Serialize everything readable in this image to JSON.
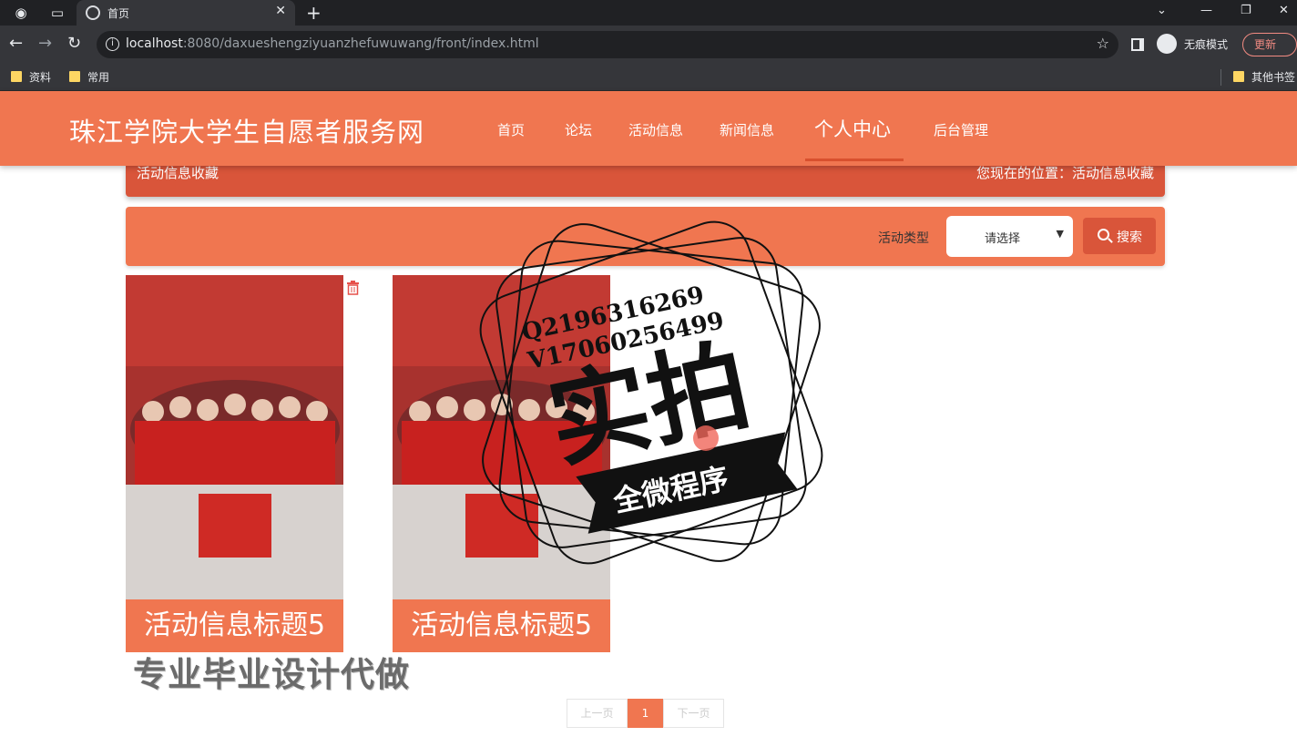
{
  "browser": {
    "tab_title": "首页",
    "url_host": "localhost",
    "url_rest": ":8080/daxueshengziyuanzhefuwuwang/front/index.html",
    "incognito_label": "无痕模式",
    "update_label": "更新",
    "bookmarks": [
      "资料",
      "常用",
      "其他书签"
    ]
  },
  "site": {
    "title": "珠江学院大学生自愿者服务网",
    "nav": [
      "首页",
      "论坛",
      "活动信息",
      "新闻信息",
      "个人中心",
      "后台管理"
    ],
    "active_nav": "个人中心"
  },
  "breadcrumb": {
    "section": "活动信息收藏",
    "location": "您现在的位置：活动信息收藏"
  },
  "filter": {
    "label": "活动类型",
    "select_value": "请选择",
    "search_label": "搜索"
  },
  "cards": [
    {
      "title": "活动信息标题5"
    },
    {
      "title": "活动信息标题5"
    }
  ],
  "overlay": {
    "ad_text": "专业毕业设计代做",
    "stamp_line1": "Q2196316269",
    "stamp_line2": "V17060256499",
    "stamp_main": "实拍",
    "stamp_ribbon": "全微程序"
  },
  "pagination": {
    "prev": "上一页",
    "current": "1",
    "next": "下一页"
  },
  "colors": {
    "brand": "#f07650",
    "brand_dark": "#d9553a"
  }
}
